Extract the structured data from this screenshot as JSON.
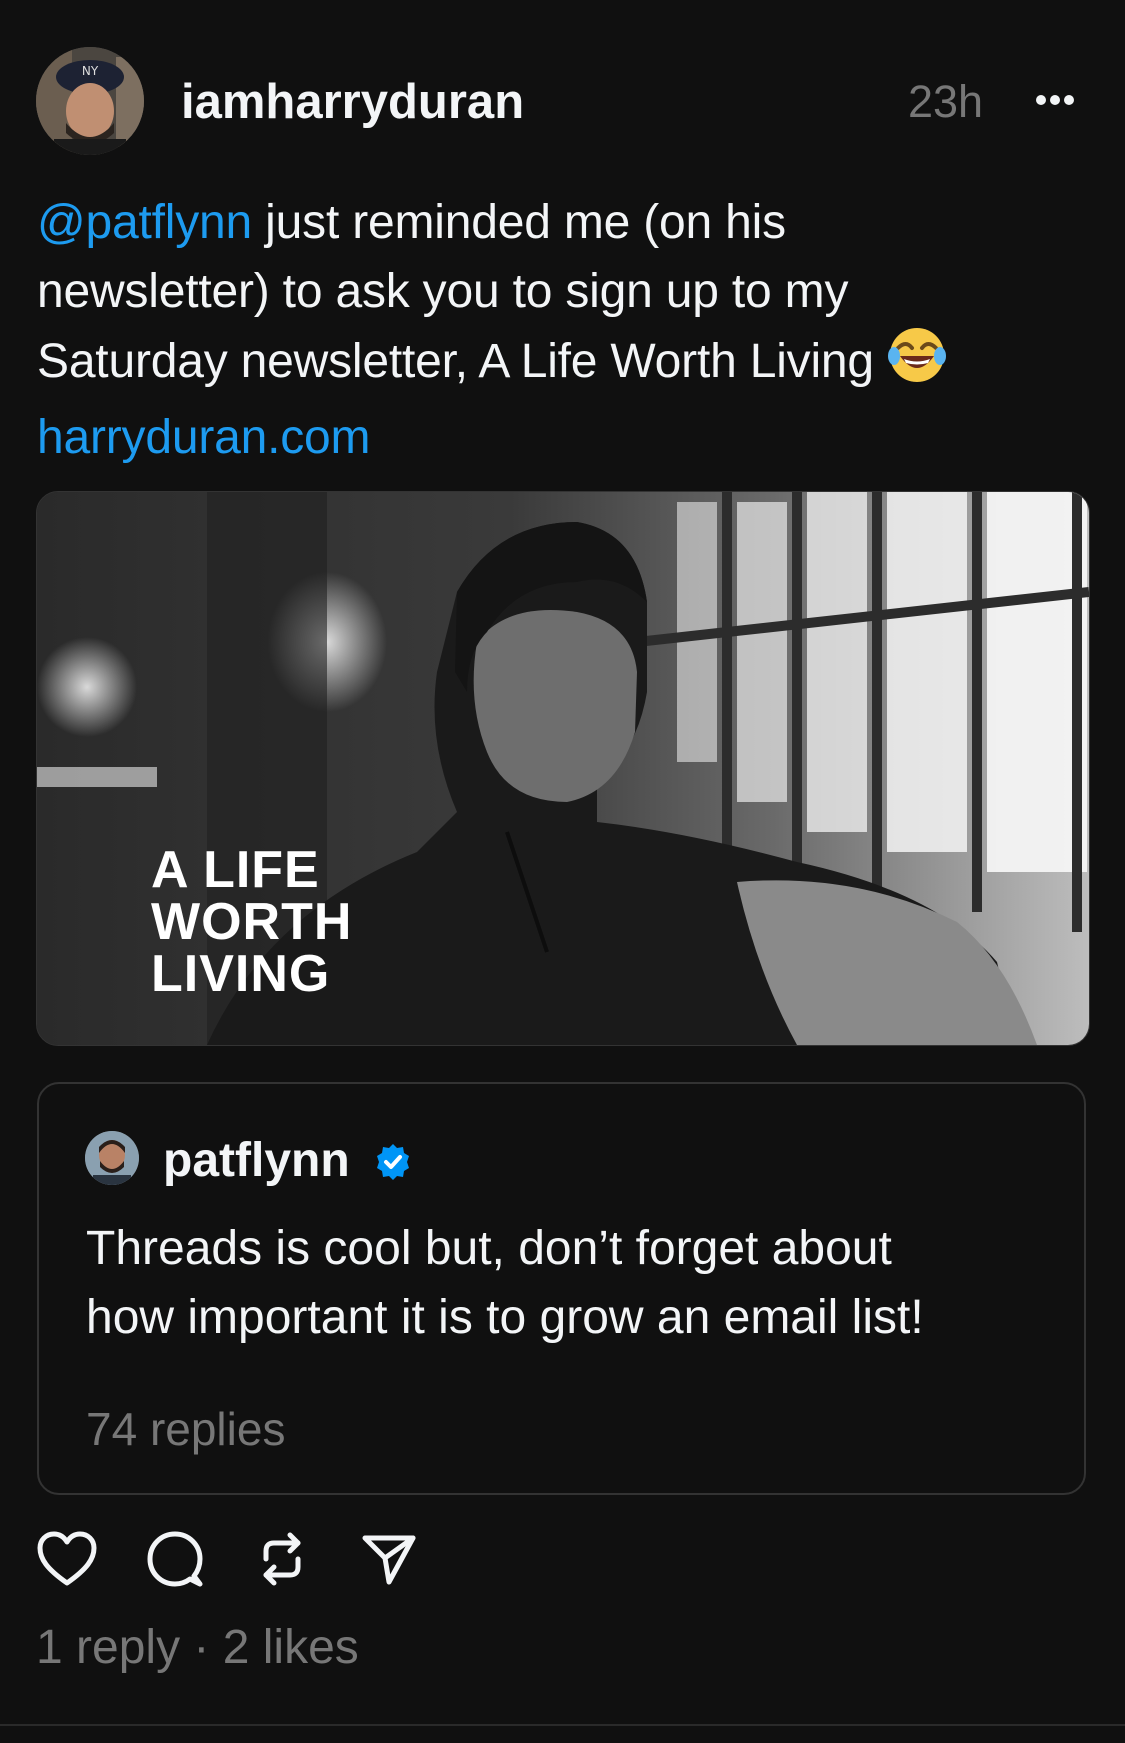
{
  "post": {
    "author": "iamharryduran",
    "timestamp": "23h",
    "text": {
      "mention": "@patflynn",
      "line1_rest": " just reminded me (on his",
      "line2": "newsletter) to ask you to sign up to my",
      "line3": "Saturday newsletter, A Life Worth Living",
      "link": "harryduran.com"
    },
    "media": {
      "title_lines": [
        "A LIFE",
        "WORTH",
        "LIVING"
      ]
    },
    "quote": {
      "author": "patflynn",
      "verified": true,
      "text_lines": [
        "Threads is cool but, don’t forget about",
        "how important it is to grow an email list!"
      ],
      "replies": "74 replies"
    },
    "stats": "1 reply · 2 likes"
  },
  "icons": {
    "more": "more-icon",
    "emoji": "laughing-tears-emoji-icon",
    "verified": "verified-badge-icon",
    "like": "heart-icon",
    "comment": "comment-icon",
    "repost": "repost-icon",
    "share": "share-icon"
  },
  "colors": {
    "background": "#101010",
    "text": "#f3f5f7",
    "secondary": "#777777",
    "link": "#1d9bf0",
    "verified": "#0095f6"
  }
}
